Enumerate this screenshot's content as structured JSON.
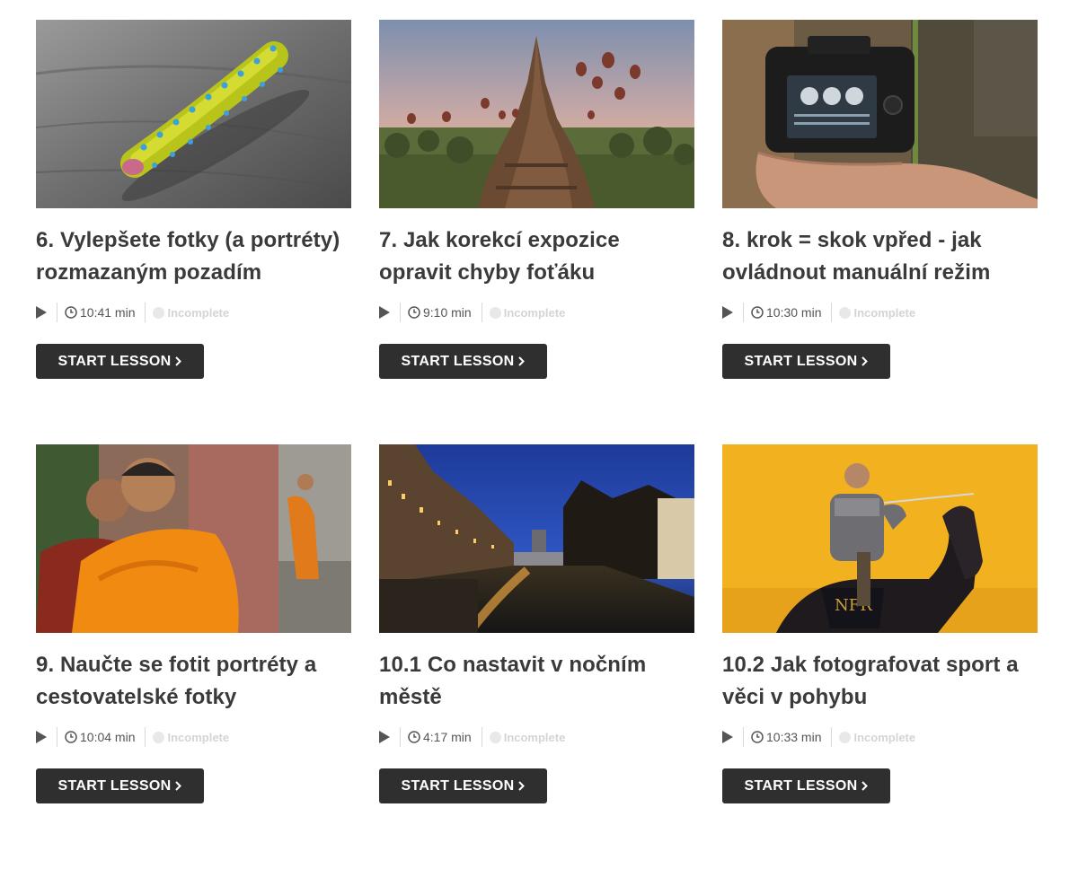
{
  "lessons": [
    {
      "title": "6. Vylepšete fotky (a portréty) rozmazaným pozadím",
      "duration": "10:41 min",
      "status": "Incomplete",
      "button": "START LESSON"
    },
    {
      "title": "7. Jak korekcí expozice opravit chyby foťáku",
      "duration": "9:10 min",
      "status": "Incomplete",
      "button": "START LESSON"
    },
    {
      "title": "8. krok = skok vpřed - jak ovládnout manuální režim",
      "duration": "10:30 min",
      "status": "Incomplete",
      "button": "START LESSON"
    },
    {
      "title": "9. Naučte se fotit portréty a cestovatelské fotky",
      "duration": "10:04 min",
      "status": "Incomplete",
      "button": "START LESSON"
    },
    {
      "title": "10.1 Co nastavit v nočním městě",
      "duration": "4:17 min",
      "status": "Incomplete",
      "button": "START LESSON"
    },
    {
      "title": "10.2 Jak fotografovat sport a věci v pohybu",
      "duration": "10:33 min",
      "status": "Incomplete",
      "button": "START LESSON"
    }
  ],
  "icons": {
    "play": "play-icon",
    "clock": "clock-icon",
    "status": "incomplete-dot-icon",
    "chevron": "chevron-right-icon"
  },
  "colors": {
    "button_bg": "#2f2f2f",
    "button_text": "#ffffff",
    "title": "#3a3a3a",
    "status_muted": "#d4d4d4"
  }
}
